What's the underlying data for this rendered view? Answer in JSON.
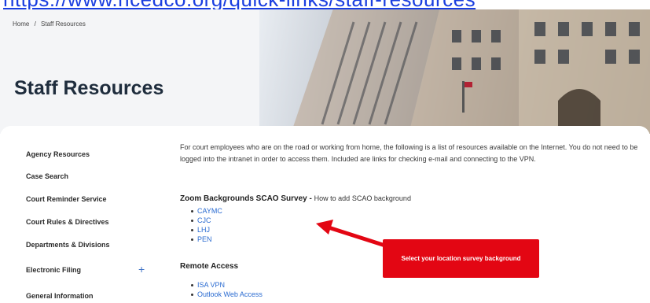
{
  "banner": {
    "url_text": "https://www.ncedco.org/quick-links/staff-resources"
  },
  "breadcrumb": {
    "home": "Home",
    "separator": "/",
    "current": "Staff Resources"
  },
  "page": {
    "title": "Staff Resources"
  },
  "sidebar": {
    "items": [
      {
        "label": "Agency Resources"
      },
      {
        "label": "Case Search"
      },
      {
        "label": "Court Reminder Service"
      },
      {
        "label": "Court Rules & Directives"
      },
      {
        "label": "Departments & Divisions"
      },
      {
        "label": "Electronic Filing",
        "expand_icon": "+"
      },
      {
        "label": "General Information"
      }
    ]
  },
  "main": {
    "intro": "For court employees who are on the road or working from home, the following is a list of resources available on the Internet. You do not need to be logged into the intranet in order to access them. Included are links for checking e-mail and connecting to the VPN.",
    "zoom": {
      "heading": "Zoom Backgrounds SCAO Survey -",
      "howto_text": "How to add",
      "howto_link": "SCAO background",
      "links": [
        "CAYMC",
        "CJC",
        "LHJ",
        "PEN"
      ]
    },
    "remote": {
      "heading": "Remote Access",
      "links": [
        "ISA VPN",
        "Outlook Web Access"
      ]
    }
  },
  "callout": {
    "text": "Select your location survey background"
  },
  "colors": {
    "accent_red": "#e30613",
    "link_blue": "#2a6bd1",
    "title": "#1f2d3d"
  }
}
